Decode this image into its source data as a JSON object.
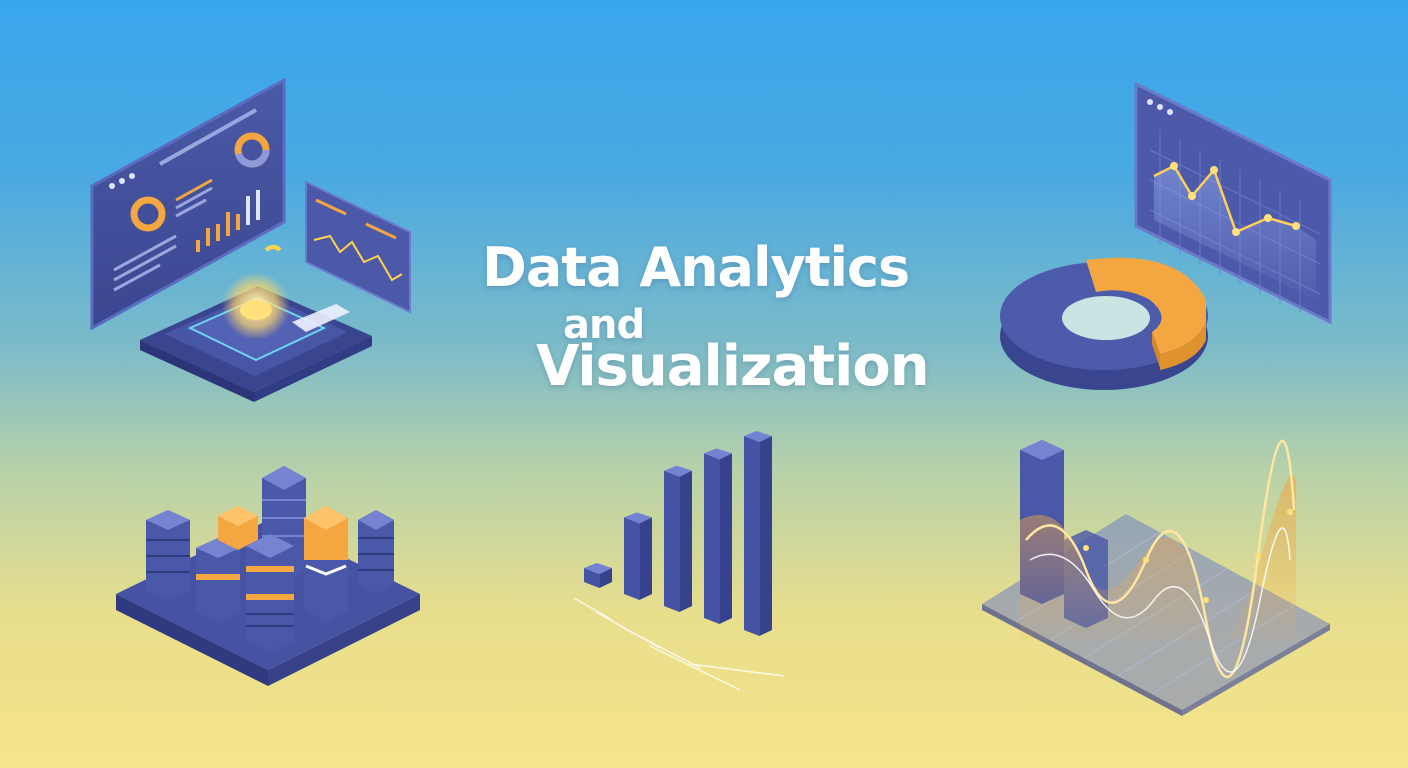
{
  "title": {
    "line1": "Data Analytics",
    "line2": "and",
    "line3": "Visualization"
  },
  "colors": {
    "sky_top": "#39a6ec",
    "sand_bottom": "#f6e48a",
    "panel_navy": "#3f4a93",
    "accent_orange": "#f4a640",
    "accent_glow": "#ffe07a"
  },
  "icons": [
    "dashboard-illustration",
    "line-chart-panel",
    "donut-chart-3d",
    "isometric-bar-city",
    "rising-bar-chart",
    "wave-bar-chart-3d"
  ],
  "rising_bars": {
    "values": [
      1,
      2,
      4,
      5,
      6
    ]
  }
}
